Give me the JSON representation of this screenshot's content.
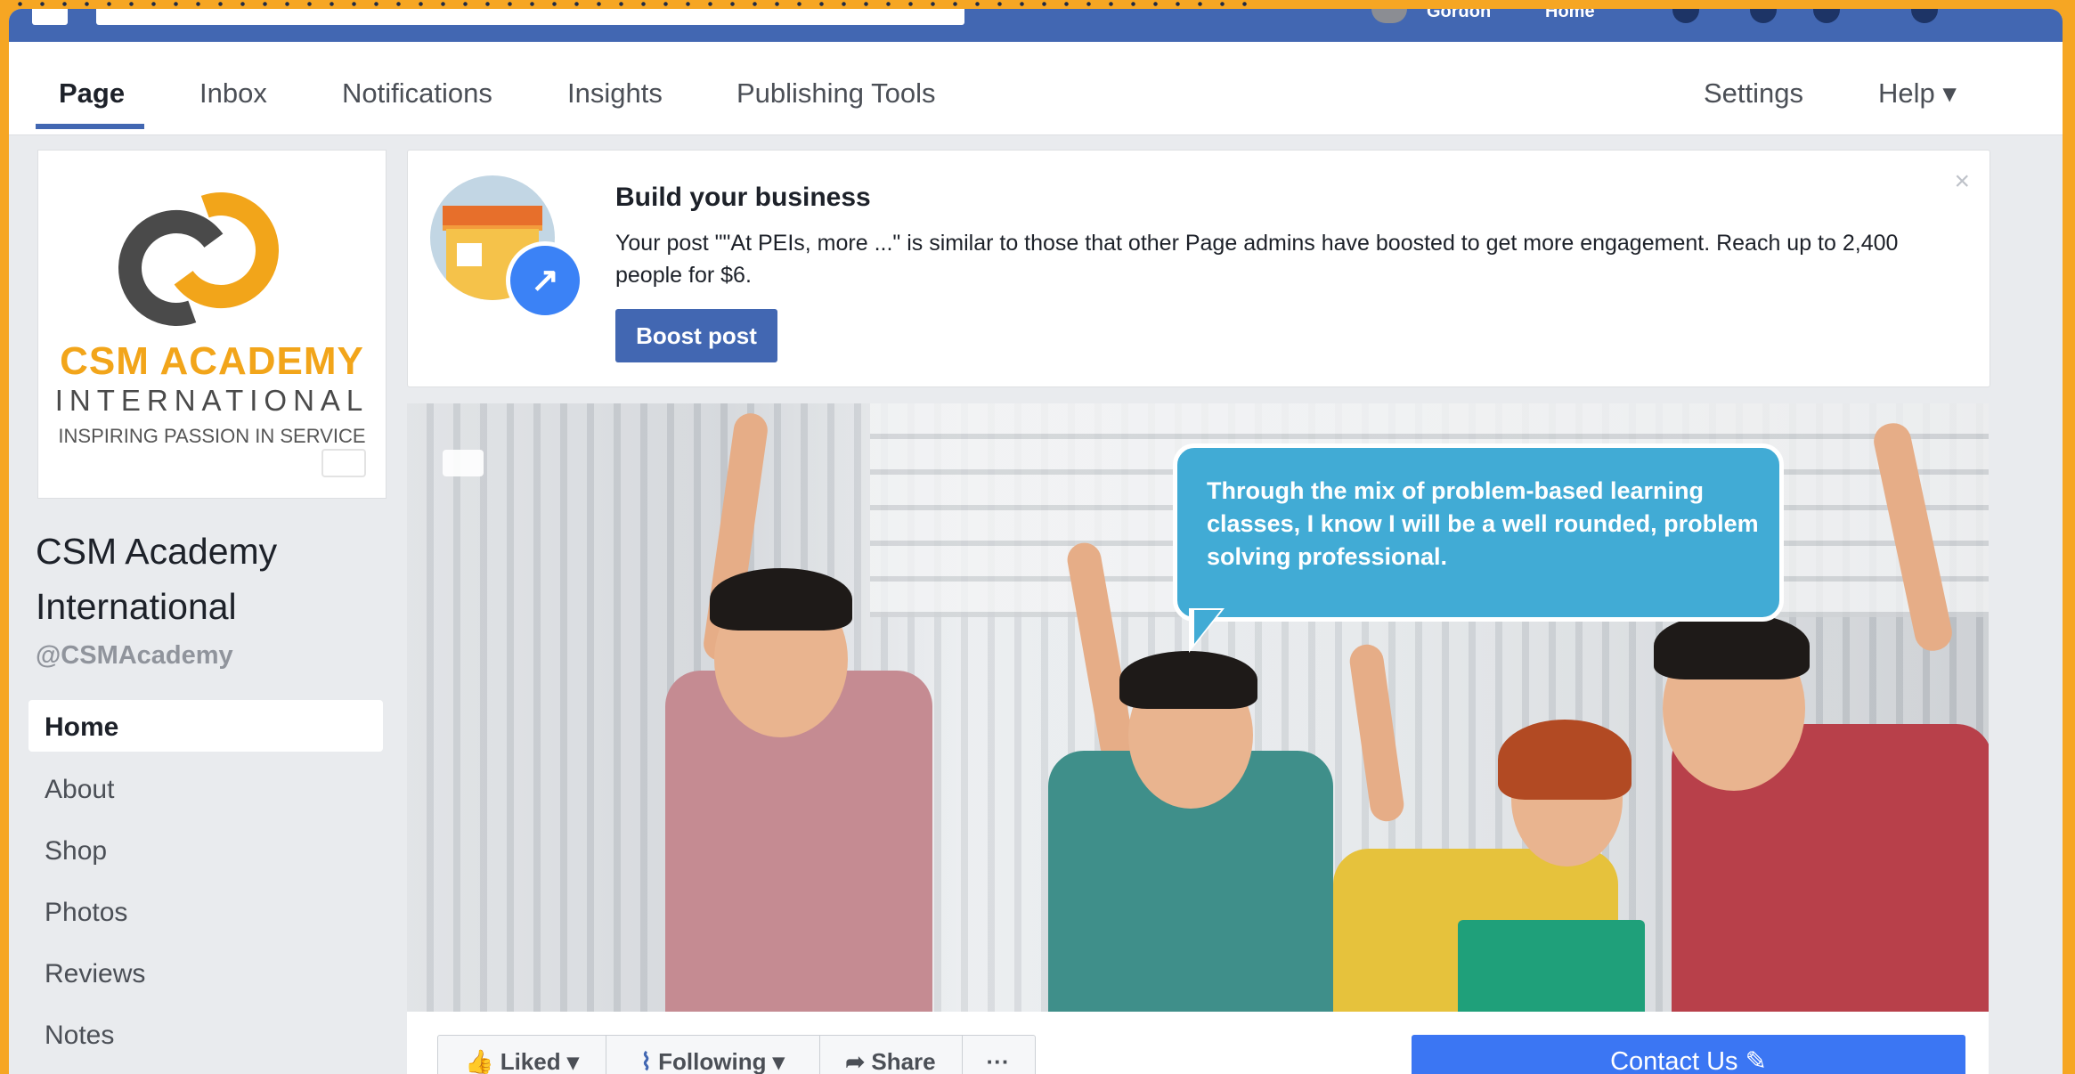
{
  "top_bar": {
    "user_name": "Gordon",
    "home_label": "Home"
  },
  "nav": {
    "tabs": [
      "Page",
      "Inbox",
      "Notifications",
      "Insights",
      "Publishing Tools"
    ],
    "settings_label": "Settings",
    "help_label": "Help ▾"
  },
  "profile": {
    "logo_line1": "CSM ACADEMY",
    "logo_line2": "INTERNATIONAL",
    "logo_line3": "INSPIRING PASSION IN SERVICE",
    "page_name": "CSM Academy International",
    "handle": "@CSMAcademy"
  },
  "sidebar": {
    "items": [
      "Home",
      "About",
      "Shop",
      "Photos",
      "Reviews",
      "Notes"
    ],
    "active": "Home"
  },
  "boost": {
    "title": "Build your business",
    "body": "Your post \"\"At PEIs, more ...\" is similar to those that other Page admins have boosted to get more engagement. Reach up to 2,400 people for $6.",
    "button": "Boost post",
    "close": "×"
  },
  "cover": {
    "bubble_text": "Through the mix of problem-based learning classes, I know I will be a well rounded, problem solving professional."
  },
  "actions": {
    "liked": "Liked",
    "following": "Following",
    "share": "Share",
    "more": "···",
    "contact": "Contact Us ✎"
  },
  "colors": {
    "brand_blue": "#4267b2",
    "accent_orange": "#f2a51a",
    "bubble_blue": "#41abd5",
    "frame_orange": "#f6a623"
  }
}
